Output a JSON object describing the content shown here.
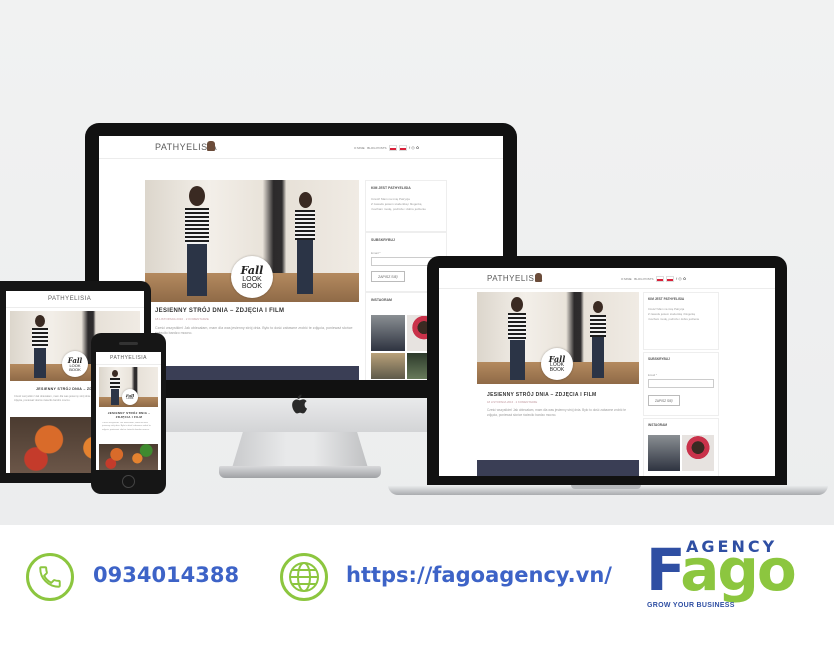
{
  "site": {
    "logo": "PATHYELISIA",
    "nav": [
      "O MNIE",
      "BLOG POSTS"
    ],
    "hero_badge": {
      "line1": "Fall",
      "line2": "LOOK",
      "line3": "BOOK"
    },
    "post_title": "JESIENNY STRÓJ DNIA – ZDJĘCIA I FILM",
    "post_title_short": "JESIENNY STRÓJ DNIA – ZDJĘCIA I FILM",
    "post_meta": "18 LISTOPADA 2016 · 2 KOMENTARZE",
    "post_excerpt": "Cześć wszystkim! Jak obiecałam, mam dla was jesienny strój dnia. Było to dość zabawne zrobić te zdjęcia, ponieważ słońce świeciło bardzo mocno.",
    "sidebar": {
      "about_title": "KIM JEST PATHYELISIA",
      "about_text": "Cześć! Mam na imię Patrycja\nZ zawodu jestem studentką i blogerką\ni kocham modę, podróże i dobre jedzenie",
      "subscribe_title": "SUBSKRYBUJ",
      "email_label": "Email *",
      "subscribe_button": "ZAPISZ SIĘ!",
      "instagram_title": "INSTAGRAM"
    }
  },
  "contact": {
    "phone": "0934014388",
    "website": "https://fagoagency.vn/"
  },
  "brand": {
    "agency": "AGENCY",
    "fago": "Fago",
    "tagline": "GROW YOUR BUSINESS"
  },
  "colors": {
    "contact_text": "#3d63c7",
    "icon_green": "#8cc63f",
    "brand_blue": "#2f4fa3",
    "brand_green": "#8cc63f"
  },
  "icons": [
    "phone-icon",
    "globe-icon",
    "apple-logo-icon"
  ]
}
